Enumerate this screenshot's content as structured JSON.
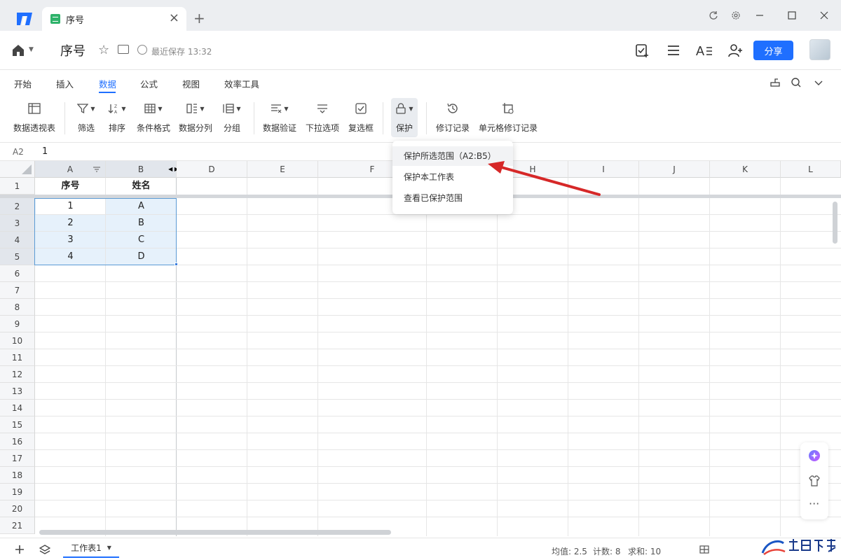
{
  "titlebar": {
    "tab_label": "序号",
    "tab_close": "×",
    "new_tab": "+"
  },
  "header": {
    "doc_title": "序号",
    "save_status": "最近保存 13:32",
    "share_label": "分享"
  },
  "menu": {
    "tabs": [
      "开始",
      "插入",
      "数据",
      "公式",
      "视图",
      "效率工具"
    ],
    "active": "数据"
  },
  "ribbon": {
    "items": [
      "数据透视表",
      "筛选",
      "排序",
      "条件格式",
      "数据分列",
      "分组",
      "数据验证",
      "下拉选项",
      "复选框",
      "保护",
      "修订记录",
      "单元格修订记录"
    ]
  },
  "formula": {
    "cell_ref": "A2",
    "value": "1"
  },
  "grid": {
    "columns": [
      "A",
      "B",
      "D",
      "E",
      "F",
      "H",
      "I",
      "J",
      "K",
      "L"
    ],
    "rows": [
      "1",
      "2",
      "3",
      "4",
      "5",
      "6",
      "7",
      "8",
      "9",
      "10",
      "11",
      "12",
      "13",
      "14",
      "15",
      "16",
      "17",
      "18",
      "19",
      "20",
      "21"
    ],
    "headers": [
      "序号",
      "姓名"
    ],
    "data": [
      [
        "1",
        "A"
      ],
      [
        "2",
        "B"
      ],
      [
        "3",
        "C"
      ],
      [
        "4",
        "D"
      ]
    ]
  },
  "dropdown": {
    "items": [
      "保护所选范围（A2:B5）",
      "保护本工作表",
      "查看已保护范围"
    ]
  },
  "bottom": {
    "sheet_name": "工作表1",
    "avg": "均值: 2.5",
    "count": "计数: 8",
    "sum": "求和: 10"
  },
  "colors": {
    "accent": "#1f6fff",
    "selection": "#e6f1fb",
    "arrow": "#d62828"
  }
}
